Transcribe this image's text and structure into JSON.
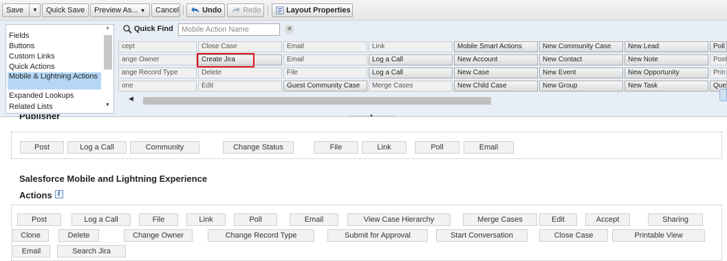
{
  "toolbar": {
    "save": "Save",
    "quick_save": "Quick Save",
    "preview_as": "Preview As...",
    "cancel": "Cancel",
    "undo": "Undo",
    "redo": "Redo",
    "layout_properties": "Layout Properties"
  },
  "palette": {
    "categories": [
      "Fields",
      "Buttons",
      "Custom Links",
      "Quick Actions",
      "Mobile & Lightning Actions",
      "Expanded Lookups",
      "Related Lists"
    ],
    "selected_category": "Mobile & Lightning Actions",
    "quick_find_label": "Quick Find",
    "quick_find_placeholder": "Mobile Action Name",
    "cells": [
      [
        "cept",
        "Close Case",
        "Email",
        "Link",
        "Mobile Smart Actions",
        "New Community Case",
        "New Lead",
        "Poll"
      ],
      [
        "ange Owner",
        "Create Jira",
        "Email",
        "Log a Call",
        "New Account",
        "New Contact",
        "New Note",
        "Post"
      ],
      [
        "ange Record Type",
        "Delete",
        "File",
        "Log a Call",
        "New Case",
        "New Event",
        "New Opportunity",
        "Prin"
      ],
      [
        "one",
        "Edit",
        "Guest Community Case",
        "Merge Cases",
        "New Child Case",
        "New Group",
        "New Task",
        "Que"
      ]
    ]
  },
  "publisher": {
    "title": "Publisher",
    "actions": [
      "Post",
      "Log a Call",
      "Community",
      "Change Status",
      "File",
      "Link",
      "Poll",
      "Email"
    ]
  },
  "mobile_section": {
    "title_line1": "Salesforce Mobile and Lightning Experience",
    "title_line2": "Actions",
    "info": "i",
    "row1": [
      "Post",
      "Log a Call",
      "File",
      "Link",
      "Poll",
      "Email",
      "View Case Hierarchy",
      "Merge Cases",
      "Edit",
      "Accept",
      "Sharing"
    ],
    "row2": [
      "Clone",
      "Delete",
      "Change Owner",
      "Change Record Type",
      "Submit for Approval",
      "Start Conversation",
      "Close Case",
      "Printable View"
    ],
    "row3": [
      "Email",
      "Search Jira"
    ]
  }
}
